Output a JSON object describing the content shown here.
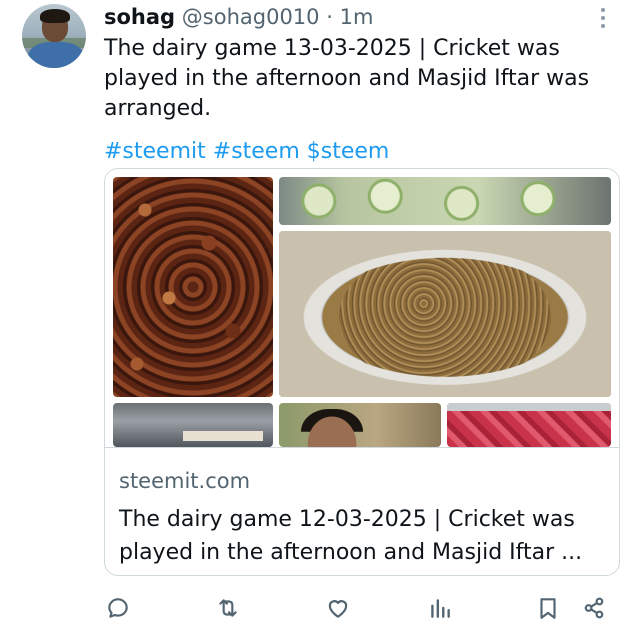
{
  "post": {
    "author_name": "sohag",
    "handle": "@sohag0010",
    "separator": "·",
    "time": "1m",
    "text": "The dairy game 13-03-2025 |  Cricket was played in the afternoon and Masjid Iftar was arranged.",
    "hashtags": "#steemit #steem $steem"
  },
  "link_card": {
    "domain": "steemit.com",
    "title": "The dairy game 12-03-2025 | Cricket was played in the afternoon and Masjid Iftar ..."
  },
  "icons": {
    "more": "more-vertical-icon",
    "reply": "reply-icon",
    "repost": "repost-icon",
    "like": "heart-icon",
    "views": "views-icon",
    "bookmark": "bookmark-icon",
    "share": "share-icon"
  },
  "colors": {
    "accent": "#1d9bf0",
    "text": "#0f1419",
    "muted": "#536471",
    "border": "#cfd9de"
  }
}
